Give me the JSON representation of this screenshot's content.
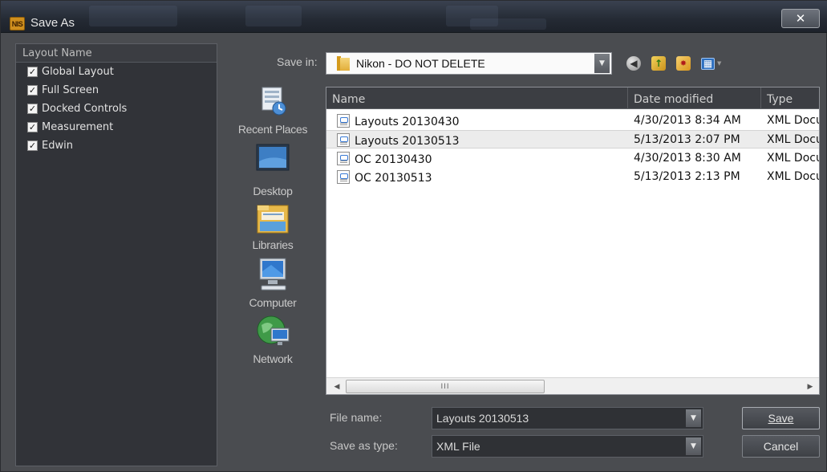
{
  "window": {
    "title": "Save As",
    "app_icon_text": "NIS"
  },
  "left_panel": {
    "header": "Layout Name",
    "items": [
      {
        "label": "Global Layout",
        "checked": true
      },
      {
        "label": "Full Screen",
        "checked": true
      },
      {
        "label": "Docked Controls",
        "checked": true
      },
      {
        "label": "Measurement",
        "checked": true
      },
      {
        "label": "Edwin",
        "checked": true
      }
    ]
  },
  "save_in": {
    "label": "Save in:",
    "value": "Nikon - DO NOT DELETE"
  },
  "toolbar": {
    "icons": [
      "back-icon",
      "up-folder-icon",
      "new-folder-icon",
      "view-menu-icon"
    ]
  },
  "places": [
    {
      "label": "Recent Places",
      "icon": "recent-places-icon"
    },
    {
      "label": "Desktop",
      "icon": "desktop-icon"
    },
    {
      "label": "Libraries",
      "icon": "libraries-icon"
    },
    {
      "label": "Computer",
      "icon": "computer-icon"
    },
    {
      "label": "Network",
      "icon": "network-icon"
    }
  ],
  "file_list": {
    "columns": [
      "Name",
      "Date modified",
      "Type"
    ],
    "rows": [
      {
        "name": "Layouts 20130430",
        "date": "4/30/2013 8:34 AM",
        "type": "XML Document",
        "selected": false
      },
      {
        "name": "Layouts 20130513",
        "date": "5/13/2013 2:07 PM",
        "type": "XML Document",
        "selected": true
      },
      {
        "name": "OC 20130430",
        "date": "4/30/2013 8:30 AM",
        "type": "XML Document",
        "selected": false
      },
      {
        "name": "OC 20130513",
        "date": "5/13/2013 2:13 PM",
        "type": "XML Document",
        "selected": false
      }
    ],
    "scroll_grip": "III"
  },
  "file_name": {
    "label": "File name:",
    "value": "Layouts 20130513"
  },
  "save_as_type": {
    "label": "Save as type:",
    "value": "XML File"
  },
  "buttons": {
    "save": "Save",
    "cancel": "Cancel"
  },
  "colors": {
    "window_bg": "#4a4c50",
    "panel_bg": "#313338",
    "list_bg": "#ffffff",
    "selected_row": "#ececec"
  }
}
